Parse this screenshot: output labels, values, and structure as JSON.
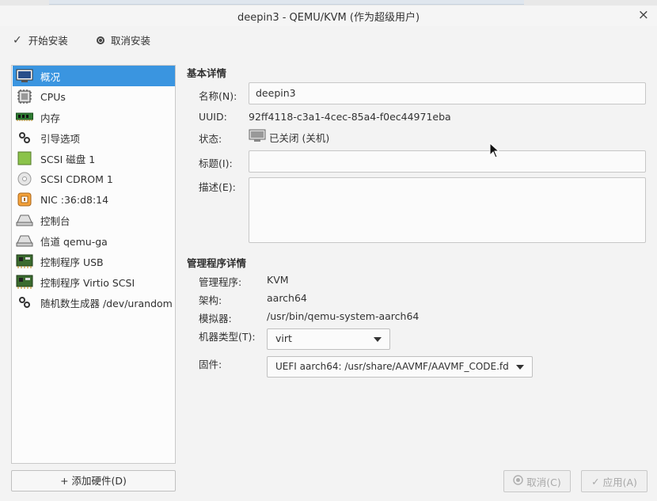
{
  "window": {
    "title": "deepin3 - QEMU/KVM (作为超级用户)",
    "close_glyph": "×"
  },
  "toolbar": {
    "begin_install": "开始安装",
    "cancel_install": "取消安装"
  },
  "sidebar": {
    "items": [
      {
        "label": "概况",
        "icon": "monitor-icon",
        "selected": true
      },
      {
        "label": "CPUs",
        "icon": "cpu-icon"
      },
      {
        "label": "内存",
        "icon": "memory-icon"
      },
      {
        "label": "引导选项",
        "icon": "gears-icon"
      },
      {
        "label": "SCSI 磁盘 1",
        "icon": "disk-icon"
      },
      {
        "label": "SCSI CDROM 1",
        "icon": "cdrom-icon"
      },
      {
        "label": "NIC :36:d8:14",
        "icon": "network-icon"
      },
      {
        "label": "控制台",
        "icon": "console-icon"
      },
      {
        "label": "信道 qemu-ga",
        "icon": "channel-icon"
      },
      {
        "label": "控制程序 USB",
        "icon": "controller-icon"
      },
      {
        "label": "控制程序 Virtio SCSI",
        "icon": "controller-icon"
      },
      {
        "label": "随机数生成器 /dev/urandom",
        "icon": "gears-icon"
      }
    ],
    "add_hardware": "添加硬件(D)",
    "add_glyph": "+"
  },
  "basic": {
    "section_title": "基本详情",
    "name_label": "名称(N):",
    "name_value": "deepin3",
    "uuid_label": "UUID:",
    "uuid_value": "92ff4118-c3a1-4cec-85a4-f0ec44971eba",
    "status_label": "状态:",
    "status_value": "已关闭 (关机)",
    "title_label": "标题(I):",
    "title_value": "",
    "desc_label": "描述(E):",
    "desc_value": ""
  },
  "hypervisor": {
    "section_title": "管理程序详情",
    "hv_label": "管理程序:",
    "hv_value": "KVM",
    "arch_label": "架构:",
    "arch_value": "aarch64",
    "emu_label": "模拟器:",
    "emu_value": "/usr/bin/qemu-system-aarch64",
    "machine_label": "机器类型(T):",
    "machine_value": "virt",
    "firmware_label": "固件:",
    "firmware_value": "UEFI aarch64: /usr/share/AAVMF/AAVMF_CODE.fd"
  },
  "buttons": {
    "cancel": "取消(C)",
    "apply": "应用(A)"
  },
  "colors": {
    "selection": "#3a95e0",
    "accent_green": "#8bc34a"
  }
}
